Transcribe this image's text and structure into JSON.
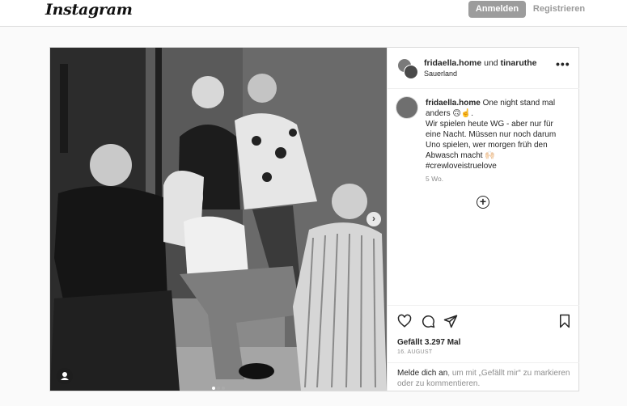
{
  "header": {
    "logo": "Instagram",
    "login_label": "Anmelden",
    "register_label": "Registrieren"
  },
  "post": {
    "header": {
      "user1": "fridaella.home",
      "connector": "und",
      "user2": "tinaruthe",
      "location": "Sauerland"
    },
    "caption": {
      "user": "fridaella.home",
      "line1": "One night stand mal",
      "line2": "anders 🙃☝️.",
      "line3": "Wir spielen heute WG - aber nur für",
      "line4": "eine Nacht. Müssen nur noch darum",
      "line5": "Uno spielen, wer morgen früh den",
      "line6": "Abwasch macht 🙌🏻",
      "hashtag": "#crewloveistruelove"
    },
    "time_ago": "5 Wo.",
    "likes": "Gefällt 3.297 Mal",
    "date": "16. AUGUST",
    "login_prompt": {
      "link": "Melde dich an",
      "rest": ", um mit „Gefällt mir“ zu markieren oder zu kommentieren."
    },
    "carousel": {
      "slides": 3,
      "active_index": 0,
      "next_arrow": "›"
    }
  },
  "icons": {
    "more": "more-options-icon",
    "like": "heart-icon",
    "comment": "comment-icon",
    "share": "send-icon",
    "save": "bookmark-icon",
    "add_comment": "plus-circle-icon",
    "tagged_users": "user-tag-icon"
  },
  "colors": {
    "login_button_bg": "#9c9c9c",
    "text": "#262626",
    "muted": "#8e8e8e",
    "border": "#dbdbdb"
  }
}
